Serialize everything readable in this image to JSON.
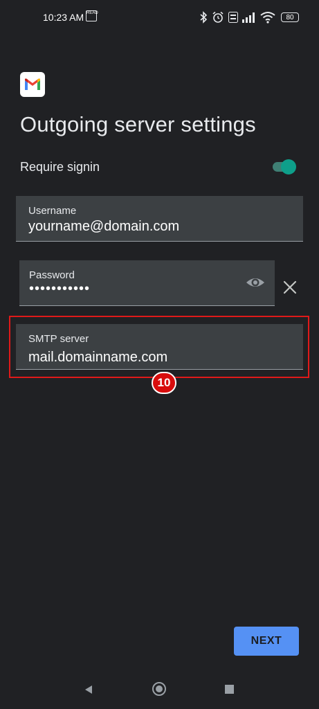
{
  "status_bar": {
    "time": "10:23 AM",
    "small_icon_text": "READ",
    "battery": "80",
    "icons": [
      "bluetooth-icon",
      "alarm-icon",
      "volte-icon",
      "signal-icon",
      "wifi-icon",
      "battery-icon"
    ]
  },
  "header": {
    "logo": "gmail-logo",
    "title": "Outgoing server settings"
  },
  "require_signin": {
    "label": "Require signin",
    "enabled": true
  },
  "username": {
    "label": "Username",
    "value": "yourname@domain.com"
  },
  "password": {
    "label": "Password",
    "value": "•••••••••••"
  },
  "smtp": {
    "label": "SMTP server",
    "value": "mail.domainname.com"
  },
  "annotation": {
    "step": "10",
    "color": "#e01919"
  },
  "actions": {
    "next_label": "NEXT",
    "accent": "#5591f4"
  },
  "nav": {
    "icons": [
      "back-icon",
      "home-icon",
      "recents-icon"
    ]
  }
}
